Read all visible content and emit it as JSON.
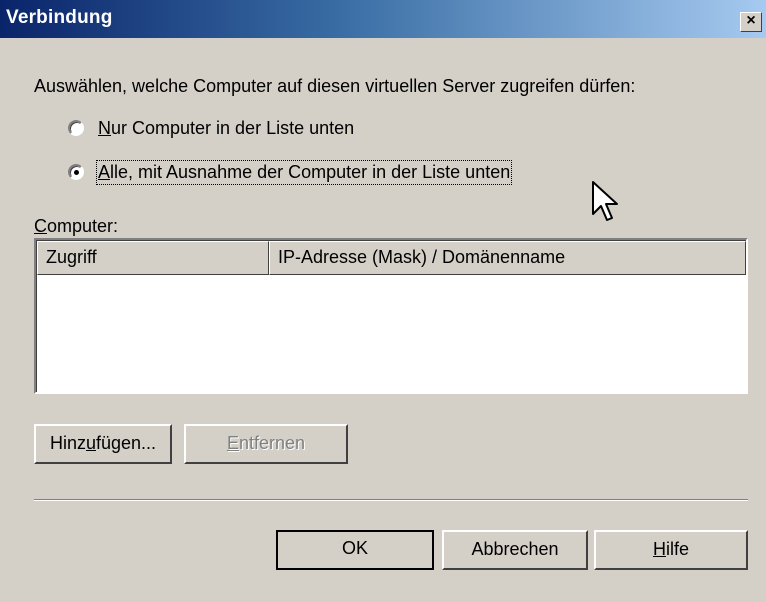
{
  "window": {
    "title": "Verbindung",
    "close_label": "×"
  },
  "instruction": "Auswählen, welche Computer auf diesen virtuellen Server zugreifen dürfen:",
  "radio_options": [
    {
      "prefix": "",
      "mnemonic": "N",
      "rest": "ur Computer in der Liste unten",
      "selected": false
    },
    {
      "prefix": "",
      "mnemonic": "A",
      "rest": "lle, mit Ausnahme der Computer in der Liste unten",
      "selected": true
    }
  ],
  "computer_list": {
    "label_mnemonic": "C",
    "label_rest": "omputer:",
    "columns": [
      "Zugriff",
      "IP-Adresse (Mask) / Domänenname"
    ],
    "rows": []
  },
  "buttons": {
    "add": {
      "prefix": "Hinz",
      "mnemonic": "u",
      "rest": "fügen..."
    },
    "remove": {
      "prefix": "",
      "mnemonic": "E",
      "rest": "ntfernen",
      "disabled": true
    },
    "ok": "OK",
    "cancel": "Abbrechen",
    "help": {
      "prefix": "",
      "mnemonic": "H",
      "rest": "ilfe"
    }
  }
}
